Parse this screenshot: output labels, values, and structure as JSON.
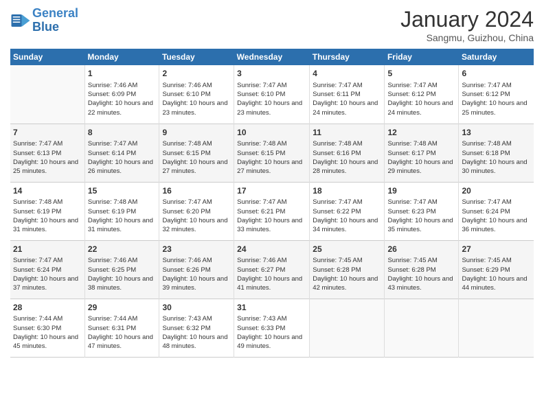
{
  "header": {
    "logo_general": "General",
    "logo_blue": "Blue",
    "month_year": "January 2024",
    "location": "Sangmu, Guizhou, China"
  },
  "days_of_week": [
    "Sunday",
    "Monday",
    "Tuesday",
    "Wednesday",
    "Thursday",
    "Friday",
    "Saturday"
  ],
  "weeks": [
    [
      {
        "day": "",
        "sunrise": "",
        "sunset": "",
        "daylight": ""
      },
      {
        "day": "1",
        "sunrise": "Sunrise: 7:46 AM",
        "sunset": "Sunset: 6:09 PM",
        "daylight": "Daylight: 10 hours and 22 minutes."
      },
      {
        "day": "2",
        "sunrise": "Sunrise: 7:46 AM",
        "sunset": "Sunset: 6:10 PM",
        "daylight": "Daylight: 10 hours and 23 minutes."
      },
      {
        "day": "3",
        "sunrise": "Sunrise: 7:47 AM",
        "sunset": "Sunset: 6:10 PM",
        "daylight": "Daylight: 10 hours and 23 minutes."
      },
      {
        "day": "4",
        "sunrise": "Sunrise: 7:47 AM",
        "sunset": "Sunset: 6:11 PM",
        "daylight": "Daylight: 10 hours and 24 minutes."
      },
      {
        "day": "5",
        "sunrise": "Sunrise: 7:47 AM",
        "sunset": "Sunset: 6:12 PM",
        "daylight": "Daylight: 10 hours and 24 minutes."
      },
      {
        "day": "6",
        "sunrise": "Sunrise: 7:47 AM",
        "sunset": "Sunset: 6:12 PM",
        "daylight": "Daylight: 10 hours and 25 minutes."
      }
    ],
    [
      {
        "day": "7",
        "sunrise": "Sunrise: 7:47 AM",
        "sunset": "Sunset: 6:13 PM",
        "daylight": "Daylight: 10 hours and 25 minutes."
      },
      {
        "day": "8",
        "sunrise": "Sunrise: 7:47 AM",
        "sunset": "Sunset: 6:14 PM",
        "daylight": "Daylight: 10 hours and 26 minutes."
      },
      {
        "day": "9",
        "sunrise": "Sunrise: 7:48 AM",
        "sunset": "Sunset: 6:15 PM",
        "daylight": "Daylight: 10 hours and 27 minutes."
      },
      {
        "day": "10",
        "sunrise": "Sunrise: 7:48 AM",
        "sunset": "Sunset: 6:15 PM",
        "daylight": "Daylight: 10 hours and 27 minutes."
      },
      {
        "day": "11",
        "sunrise": "Sunrise: 7:48 AM",
        "sunset": "Sunset: 6:16 PM",
        "daylight": "Daylight: 10 hours and 28 minutes."
      },
      {
        "day": "12",
        "sunrise": "Sunrise: 7:48 AM",
        "sunset": "Sunset: 6:17 PM",
        "daylight": "Daylight: 10 hours and 29 minutes."
      },
      {
        "day": "13",
        "sunrise": "Sunrise: 7:48 AM",
        "sunset": "Sunset: 6:18 PM",
        "daylight": "Daylight: 10 hours and 30 minutes."
      }
    ],
    [
      {
        "day": "14",
        "sunrise": "Sunrise: 7:48 AM",
        "sunset": "Sunset: 6:19 PM",
        "daylight": "Daylight: 10 hours and 31 minutes."
      },
      {
        "day": "15",
        "sunrise": "Sunrise: 7:48 AM",
        "sunset": "Sunset: 6:19 PM",
        "daylight": "Daylight: 10 hours and 31 minutes."
      },
      {
        "day": "16",
        "sunrise": "Sunrise: 7:47 AM",
        "sunset": "Sunset: 6:20 PM",
        "daylight": "Daylight: 10 hours and 32 minutes."
      },
      {
        "day": "17",
        "sunrise": "Sunrise: 7:47 AM",
        "sunset": "Sunset: 6:21 PM",
        "daylight": "Daylight: 10 hours and 33 minutes."
      },
      {
        "day": "18",
        "sunrise": "Sunrise: 7:47 AM",
        "sunset": "Sunset: 6:22 PM",
        "daylight": "Daylight: 10 hours and 34 minutes."
      },
      {
        "day": "19",
        "sunrise": "Sunrise: 7:47 AM",
        "sunset": "Sunset: 6:23 PM",
        "daylight": "Daylight: 10 hours and 35 minutes."
      },
      {
        "day": "20",
        "sunrise": "Sunrise: 7:47 AM",
        "sunset": "Sunset: 6:24 PM",
        "daylight": "Daylight: 10 hours and 36 minutes."
      }
    ],
    [
      {
        "day": "21",
        "sunrise": "Sunrise: 7:47 AM",
        "sunset": "Sunset: 6:24 PM",
        "daylight": "Daylight: 10 hours and 37 minutes."
      },
      {
        "day": "22",
        "sunrise": "Sunrise: 7:46 AM",
        "sunset": "Sunset: 6:25 PM",
        "daylight": "Daylight: 10 hours and 38 minutes."
      },
      {
        "day": "23",
        "sunrise": "Sunrise: 7:46 AM",
        "sunset": "Sunset: 6:26 PM",
        "daylight": "Daylight: 10 hours and 39 minutes."
      },
      {
        "day": "24",
        "sunrise": "Sunrise: 7:46 AM",
        "sunset": "Sunset: 6:27 PM",
        "daylight": "Daylight: 10 hours and 41 minutes."
      },
      {
        "day": "25",
        "sunrise": "Sunrise: 7:45 AM",
        "sunset": "Sunset: 6:28 PM",
        "daylight": "Daylight: 10 hours and 42 minutes."
      },
      {
        "day": "26",
        "sunrise": "Sunrise: 7:45 AM",
        "sunset": "Sunset: 6:28 PM",
        "daylight": "Daylight: 10 hours and 43 minutes."
      },
      {
        "day": "27",
        "sunrise": "Sunrise: 7:45 AM",
        "sunset": "Sunset: 6:29 PM",
        "daylight": "Daylight: 10 hours and 44 minutes."
      }
    ],
    [
      {
        "day": "28",
        "sunrise": "Sunrise: 7:44 AM",
        "sunset": "Sunset: 6:30 PM",
        "daylight": "Daylight: 10 hours and 45 minutes."
      },
      {
        "day": "29",
        "sunrise": "Sunrise: 7:44 AM",
        "sunset": "Sunset: 6:31 PM",
        "daylight": "Daylight: 10 hours and 47 minutes."
      },
      {
        "day": "30",
        "sunrise": "Sunrise: 7:43 AM",
        "sunset": "Sunset: 6:32 PM",
        "daylight": "Daylight: 10 hours and 48 minutes."
      },
      {
        "day": "31",
        "sunrise": "Sunrise: 7:43 AM",
        "sunset": "Sunset: 6:33 PM",
        "daylight": "Daylight: 10 hours and 49 minutes."
      },
      {
        "day": "",
        "sunrise": "",
        "sunset": "",
        "daylight": ""
      },
      {
        "day": "",
        "sunrise": "",
        "sunset": "",
        "daylight": ""
      },
      {
        "day": "",
        "sunrise": "",
        "sunset": "",
        "daylight": ""
      }
    ]
  ]
}
